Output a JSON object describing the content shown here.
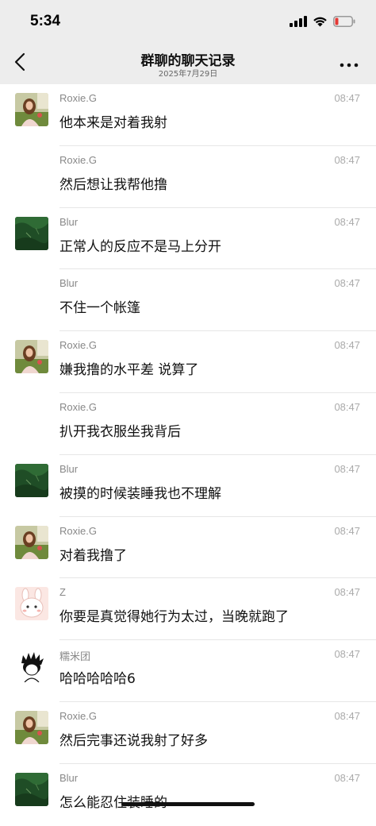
{
  "status_bar": {
    "time": "5:34",
    "icons": [
      "signal-icon",
      "wifi-icon",
      "battery-low-icon"
    ],
    "battery_color": "#e53935"
  },
  "nav": {
    "title": "群聊的聊天记录",
    "subtitle": "2025年7月29日",
    "back_icon": "back-chevron-icon",
    "more_icon": "more-icon"
  },
  "avatars": {
    "roxie": "photo-avatar-woman",
    "blur": "photo-avatar-grass",
    "z": "cartoon-avatar-rabbit",
    "nuomituan": "cartoon-avatar-sketch"
  },
  "messages": [
    {
      "sender": "Roxie.G",
      "time": "08:47",
      "text": "他本来是对着我射",
      "avatar": "roxie",
      "show_avatar": true
    },
    {
      "sender": "Roxie.G",
      "time": "08:47",
      "text": "然后想让我帮他撸",
      "avatar": "roxie",
      "show_avatar": false
    },
    {
      "sender": "Blur",
      "time": "08:47",
      "text": "正常人的反应不是马上分开",
      "avatar": "blur",
      "show_avatar": true
    },
    {
      "sender": "Blur",
      "time": "08:47",
      "text": "不住一个帐篷",
      "avatar": "blur",
      "show_avatar": false
    },
    {
      "sender": "Roxie.G",
      "time": "08:47",
      "text": "嫌我撸的水平差 说算了",
      "avatar": "roxie",
      "show_avatar": true
    },
    {
      "sender": "Roxie.G",
      "time": "08:47",
      "text": "扒开我衣服坐我背后",
      "avatar": "roxie",
      "show_avatar": false
    },
    {
      "sender": "Blur",
      "time": "08:47",
      "text": "被摸的时候装睡我也不理解",
      "avatar": "blur",
      "show_avatar": true
    },
    {
      "sender": "Roxie.G",
      "time": "08:47",
      "text": "对着我撸了",
      "avatar": "roxie",
      "show_avatar": true
    },
    {
      "sender": "Z",
      "time": "08:47",
      "text": "你要是真觉得她行为太过，当晚就跑了",
      "avatar": "z",
      "show_avatar": true
    },
    {
      "sender": "糯米团",
      "time": "08:47",
      "text": "哈哈哈哈哈6",
      "avatar": "nuomituan",
      "show_avatar": true
    },
    {
      "sender": "Roxie.G",
      "time": "08:47",
      "text": "然后完事还说我射了好多",
      "avatar": "roxie",
      "show_avatar": true
    },
    {
      "sender": "Blur",
      "time": "08:47",
      "text": "怎么能忍住装睡的",
      "avatar": "blur",
      "show_avatar": true
    }
  ]
}
